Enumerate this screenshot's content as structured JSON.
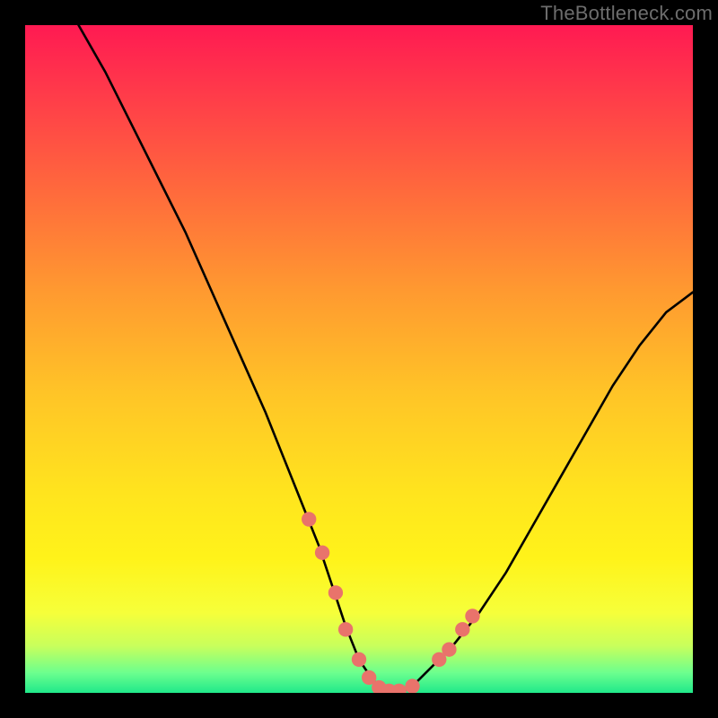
{
  "watermark": "TheBottleneck.com",
  "chart_data": {
    "type": "line",
    "title": "",
    "xlabel": "",
    "ylabel": "",
    "xlim": [
      0,
      100
    ],
    "ylim": [
      0,
      100
    ],
    "series": [
      {
        "name": "bottleneck-curve",
        "x": [
          8,
          12,
          16,
          20,
          24,
          28,
          32,
          36,
          40,
          42,
          44,
          46,
          48,
          50,
          52,
          54,
          56,
          58,
          60,
          64,
          68,
          72,
          76,
          80,
          84,
          88,
          92,
          96,
          100
        ],
        "y": [
          100,
          93,
          85,
          77,
          69,
          60,
          51,
          42,
          32,
          27,
          22,
          16,
          10,
          5,
          2,
          0,
          0,
          1,
          3,
          7,
          12,
          18,
          25,
          32,
          39,
          46,
          52,
          57,
          60
        ]
      }
    ],
    "markers": {
      "name": "highlight-dots",
      "x": [
        42.5,
        44.5,
        46.5,
        48.0,
        50.0,
        51.5,
        53.0,
        54.5,
        56.0,
        58.0,
        62.0,
        63.5,
        65.5,
        67.0
      ],
      "y": [
        26.0,
        21.0,
        15.0,
        9.5,
        5.0,
        2.3,
        0.8,
        0.3,
        0.3,
        1.0,
        5.0,
        6.5,
        9.5,
        11.5
      ]
    },
    "background_gradient": [
      "#ff1a52",
      "#ff6a3c",
      "#ffc427",
      "#fff31a",
      "#20e98a"
    ]
  }
}
